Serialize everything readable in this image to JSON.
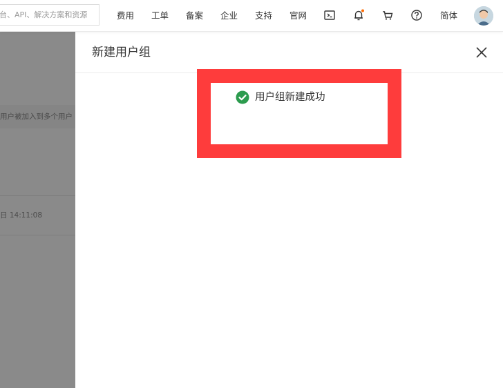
{
  "header": {
    "search_placeholder": "台、API、解决方案和资源",
    "nav": {
      "billing": "费用",
      "ticket": "工单",
      "filing": "备案",
      "enterprise": "企业",
      "support": "支持",
      "website": "官网",
      "language": "简体"
    },
    "icons": [
      "terminal-icon",
      "bell-icon",
      "cart-icon",
      "help-icon"
    ],
    "notification_dot_color": "#ff6a00"
  },
  "background": {
    "row_text": "用户被加入到多个用户",
    "timestamp": "日 14:11:08"
  },
  "drawer": {
    "title": "新建用户组"
  },
  "toast": {
    "message": "用户组新建成功",
    "status": "success",
    "icon_color": "#2c9b4e",
    "highlight_color": "#fe3c3c"
  }
}
